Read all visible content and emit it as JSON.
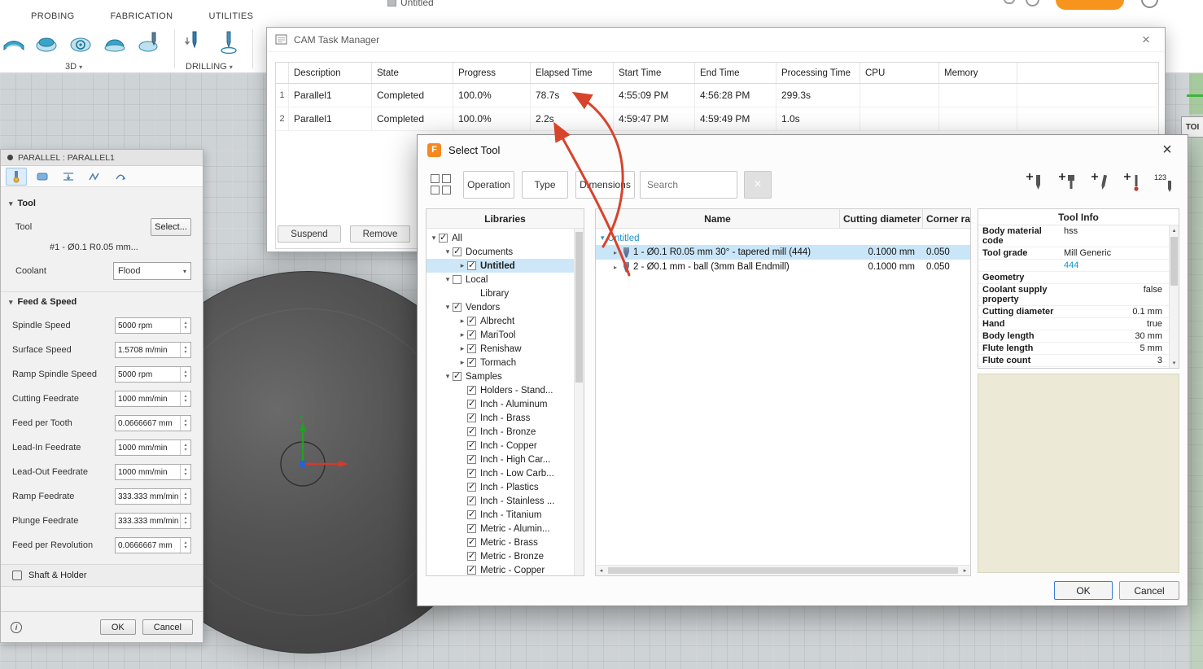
{
  "icons": {
    "tri_down": "▾",
    "tri_right": "▸",
    "dropdown": "▾",
    "close": "×",
    "check": "✓",
    "info": "i",
    "left": "◂",
    "right": "▸",
    "up": "▴",
    "down": "▾",
    "logo": "F",
    "renumber_label": "123"
  },
  "topbar": {
    "tabs": [
      "PROBING",
      "FABRICATION",
      "UTILITIES"
    ],
    "group_3d": "3D",
    "group_drilling": "DRILLING",
    "doc_title": "Untitled"
  },
  "viewport": {
    "axis_y_label": "Y",
    "side_panel_label": "TOI"
  },
  "parallel": {
    "title": "PARALLEL : PARALLEL1",
    "tool_section": "Tool",
    "tool_label": "Tool",
    "select_button": "Select...",
    "tool_name": "#1 - Ø0.1 R0.05 mm...",
    "coolant_label": "Coolant",
    "coolant_value": "Flood",
    "feed_section": "Feed & Speed",
    "fields": [
      {
        "label": "Spindle Speed",
        "value": "5000 rpm"
      },
      {
        "label": "Surface Speed",
        "value": "1.5708 m/min"
      },
      {
        "label": "Ramp Spindle Speed",
        "value": "5000 rpm"
      },
      {
        "label": "Cutting Feedrate",
        "value": "1000 mm/min"
      },
      {
        "label": "Feed per Tooth",
        "value": "0.0666667 mm"
      },
      {
        "label": "Lead-In Feedrate",
        "value": "1000 mm/min"
      },
      {
        "label": "Lead-Out Feedrate",
        "value": "1000 mm/min"
      },
      {
        "label": "Ramp Feedrate",
        "value": "333.333 mm/min"
      },
      {
        "label": "Plunge Feedrate",
        "value": "333.333 mm/min"
      },
      {
        "label": "Feed per Revolution",
        "value": "0.0666667 mm"
      }
    ],
    "shaft_holder": "Shaft & Holder",
    "ok": "OK",
    "cancel": "Cancel"
  },
  "task_manager": {
    "title": "CAM Task Manager",
    "columns": [
      "Description",
      "State",
      "Progress",
      "Elapsed Time",
      "Start Time",
      "End Time",
      "Processing Time",
      "CPU",
      "Memory"
    ],
    "rows": [
      {
        "n": "1",
        "cells": [
          "Parallel1",
          "Completed",
          "100.0%",
          "78.7s",
          "4:55:09 PM",
          "4:56:28 PM",
          "299.3s",
          "",
          ""
        ]
      },
      {
        "n": "2",
        "cells": [
          "Parallel1",
          "Completed",
          "100.0%",
          "2.2s",
          "4:59:47 PM",
          "4:59:49 PM",
          "1.0s",
          "",
          ""
        ]
      }
    ],
    "suspend": "Suspend",
    "remove": "Remove"
  },
  "select_tool": {
    "title": "Select Tool",
    "operation": "Operation",
    "type": "Type",
    "dimensions": "Dimensions",
    "search_placeholder": "Search",
    "libraries_header": "Libraries",
    "tree": [
      {
        "label": "All",
        "cls": "lvl0 checked",
        "chev": "▾"
      },
      {
        "label": "Documents",
        "cls": "lvl1 checked",
        "chev": "▾"
      },
      {
        "label": "Untitled",
        "cls": "lvl2 checked selected",
        "chev": "▸"
      },
      {
        "label": "Local",
        "cls": "lvl1 unchecked",
        "chev": "▾"
      },
      {
        "label": "Library",
        "cls": "lvl2 nocheck",
        "chev": ""
      },
      {
        "label": "Vendors",
        "cls": "lvl1 checked",
        "chev": "▾"
      },
      {
        "label": "Albrecht",
        "cls": "lvl2 checked",
        "chev": "▸"
      },
      {
        "label": "MariTool",
        "cls": "lvl2 checked",
        "chev": "▸"
      },
      {
        "label": "Renishaw",
        "cls": "lvl2 checked",
        "chev": "▸"
      },
      {
        "label": "Tormach",
        "cls": "lvl2 checked",
        "chev": "▸"
      },
      {
        "label": "Samples",
        "cls": "lvl1 checked",
        "chev": "▾"
      },
      {
        "label": "Holders - Stand...",
        "cls": "lvl2 checked",
        "chev": ""
      },
      {
        "label": "Inch - Aluminum",
        "cls": "lvl2 checked",
        "chev": ""
      },
      {
        "label": "Inch - Brass",
        "cls": "lvl2 checked",
        "chev": ""
      },
      {
        "label": "Inch - Bronze",
        "cls": "lvl2 checked",
        "chev": ""
      },
      {
        "label": "Inch - Copper",
        "cls": "lvl2 checked",
        "chev": ""
      },
      {
        "label": "Inch - High Car...",
        "cls": "lvl2 checked",
        "chev": ""
      },
      {
        "label": "Inch - Low Carb...",
        "cls": "lvl2 checked",
        "chev": ""
      },
      {
        "label": "Inch - Plastics",
        "cls": "lvl2 checked",
        "chev": ""
      },
      {
        "label": "Inch - Stainless ...",
        "cls": "lvl2 checked",
        "chev": ""
      },
      {
        "label": "Inch - Titanium",
        "cls": "lvl2 checked",
        "chev": ""
      },
      {
        "label": "Metric - Alumin...",
        "cls": "lvl2 checked",
        "chev": ""
      },
      {
        "label": "Metric - Brass",
        "cls": "lvl2 checked",
        "chev": ""
      },
      {
        "label": "Metric - Bronze",
        "cls": "lvl2 checked",
        "chev": ""
      },
      {
        "label": "Metric - Copper",
        "cls": "lvl2 checked",
        "chev": ""
      }
    ],
    "list": {
      "col_name": "Name",
      "col_diameter": "Cutting diameter",
      "col_corner": "Corner ra",
      "group": "Untitled",
      "rows": [
        {
          "chev": "▸",
          "name": "1 - Ø0.1 R0.05 mm 30° - tapered mill (444)",
          "dia": "0.1000 mm",
          "corner": "0.050",
          "cls": "selected"
        },
        {
          "chev": "▸",
          "name": "2 - Ø0.1 mm - ball (3mm Ball Endmill)",
          "dia": "0.1000 mm",
          "corner": "0.050",
          "cls": ""
        }
      ]
    },
    "tool_info": {
      "header": "Tool Info",
      "rows": [
        {
          "label": "Body material code",
          "value": "hss",
          "cls": "left"
        },
        {
          "label": "Tool grade",
          "value": "Mill Generic",
          "cls": "left"
        },
        {
          "label": "",
          "value": "444",
          "cls": "left link"
        },
        {
          "label": "Geometry",
          "value": "",
          "cls": "section"
        },
        {
          "label": "Coolant supply property",
          "value": "false",
          "cls": "right"
        },
        {
          "label": "Cutting diameter",
          "value": "0.1 mm",
          "cls": "right"
        },
        {
          "label": "Hand",
          "value": "true",
          "cls": "right"
        },
        {
          "label": "Body length",
          "value": "30 mm",
          "cls": "right"
        },
        {
          "label": "Flute length",
          "value": "5 mm",
          "cls": "right"
        },
        {
          "label": "Flute count",
          "value": "3",
          "cls": "right"
        }
      ]
    },
    "ok": "OK",
    "cancel": "Cancel"
  }
}
